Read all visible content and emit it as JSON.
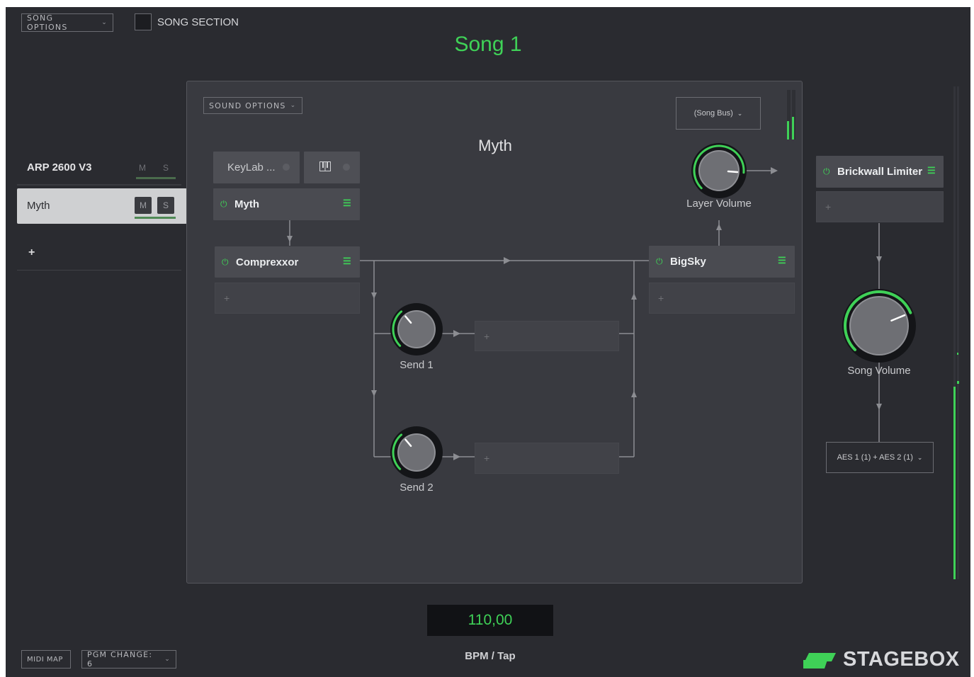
{
  "header": {
    "song_options_label": "SONG OPTIONS",
    "song_section_label": "SONG SECTION",
    "song_title": "Song 1"
  },
  "tracks": {
    "track_name": "ARP 2600 V3",
    "mute_label": "M",
    "solo_label": "S",
    "sound_name": "Myth",
    "add_label": "+"
  },
  "panel": {
    "sound_options_label": "SOUND OPTIONS",
    "output_select": "(Song Bus)",
    "sound_title": "Myth",
    "input_label": "KeyLab ...",
    "instrument_label": "Myth",
    "effect1_label": "Comprexxor",
    "effect2_label": "BigSky",
    "layer_volume_label": "Layer Volume",
    "send1_label": "Send 1",
    "send2_label": "Send 2",
    "add_slot_label": "+"
  },
  "song_bus": {
    "limiter_label": "Brickwall Limiter",
    "add_slot_label": "+",
    "song_volume_label": "Song Volume",
    "output_select": "AES 1 (1) + AES 2 (1)"
  },
  "footer": {
    "midi_map_label": "MIDI MAP",
    "pgm_change_label": "PGM CHANGE: 6",
    "bpm_value": "110,00",
    "bpm_label": "BPM / Tap",
    "brand": "STAGEBOX"
  },
  "levels": {
    "layer_volume": 0.85,
    "song_volume": 0.75,
    "send1": 0.35,
    "send2": 0.35
  },
  "icons": [
    "chevron-down-icon",
    "power-icon",
    "eq-settings-icon",
    "piano-icon",
    "plus-icon",
    "stagebox-logo-icon"
  ],
  "colors": {
    "accent": "#3fd157",
    "background": "#2a2b30",
    "panel": "#393a40"
  }
}
